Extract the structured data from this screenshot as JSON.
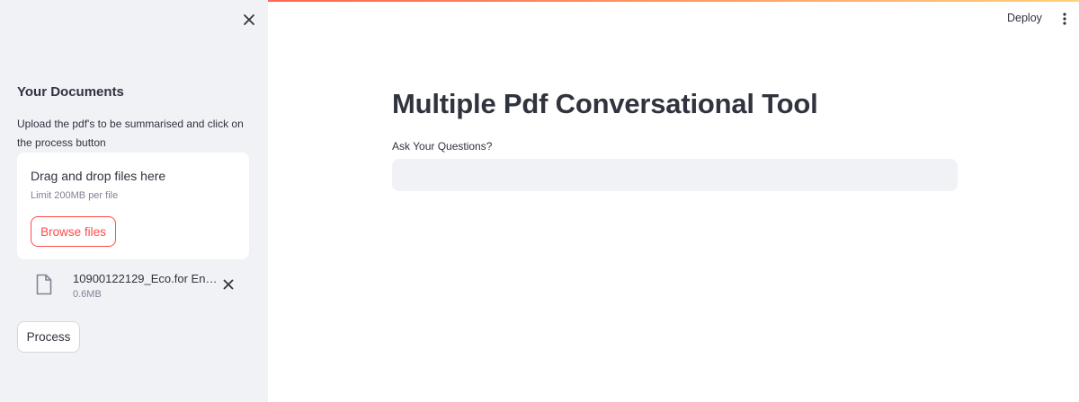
{
  "colors": {
    "accent": "#ff4b4b",
    "sidebar_bg": "#f0f2f6",
    "text": "#31333f",
    "muted": "#808495"
  },
  "sidebar": {
    "close_icon": "close-icon",
    "title": "Your Documents",
    "description": "Upload the pdf's to be summarised and click on the process button",
    "uploader": {
      "icon": "upload-cloud-icon",
      "drop_text": "Drag and drop files here",
      "limit_text": "Limit 200MB per file",
      "browse_label": "Browse files"
    },
    "file": {
      "icon": "file-icon",
      "name": "10900122129_Eco.for En…",
      "size": "0.6MB",
      "remove_icon": "close-icon"
    },
    "process_label": "Process"
  },
  "header": {
    "deploy_label": "Deploy",
    "menu_icon": "more-vertical-icon"
  },
  "main": {
    "title": "Multiple Pdf Conversational Tool",
    "input_label": "Ask Your Questions?",
    "input_value": ""
  }
}
